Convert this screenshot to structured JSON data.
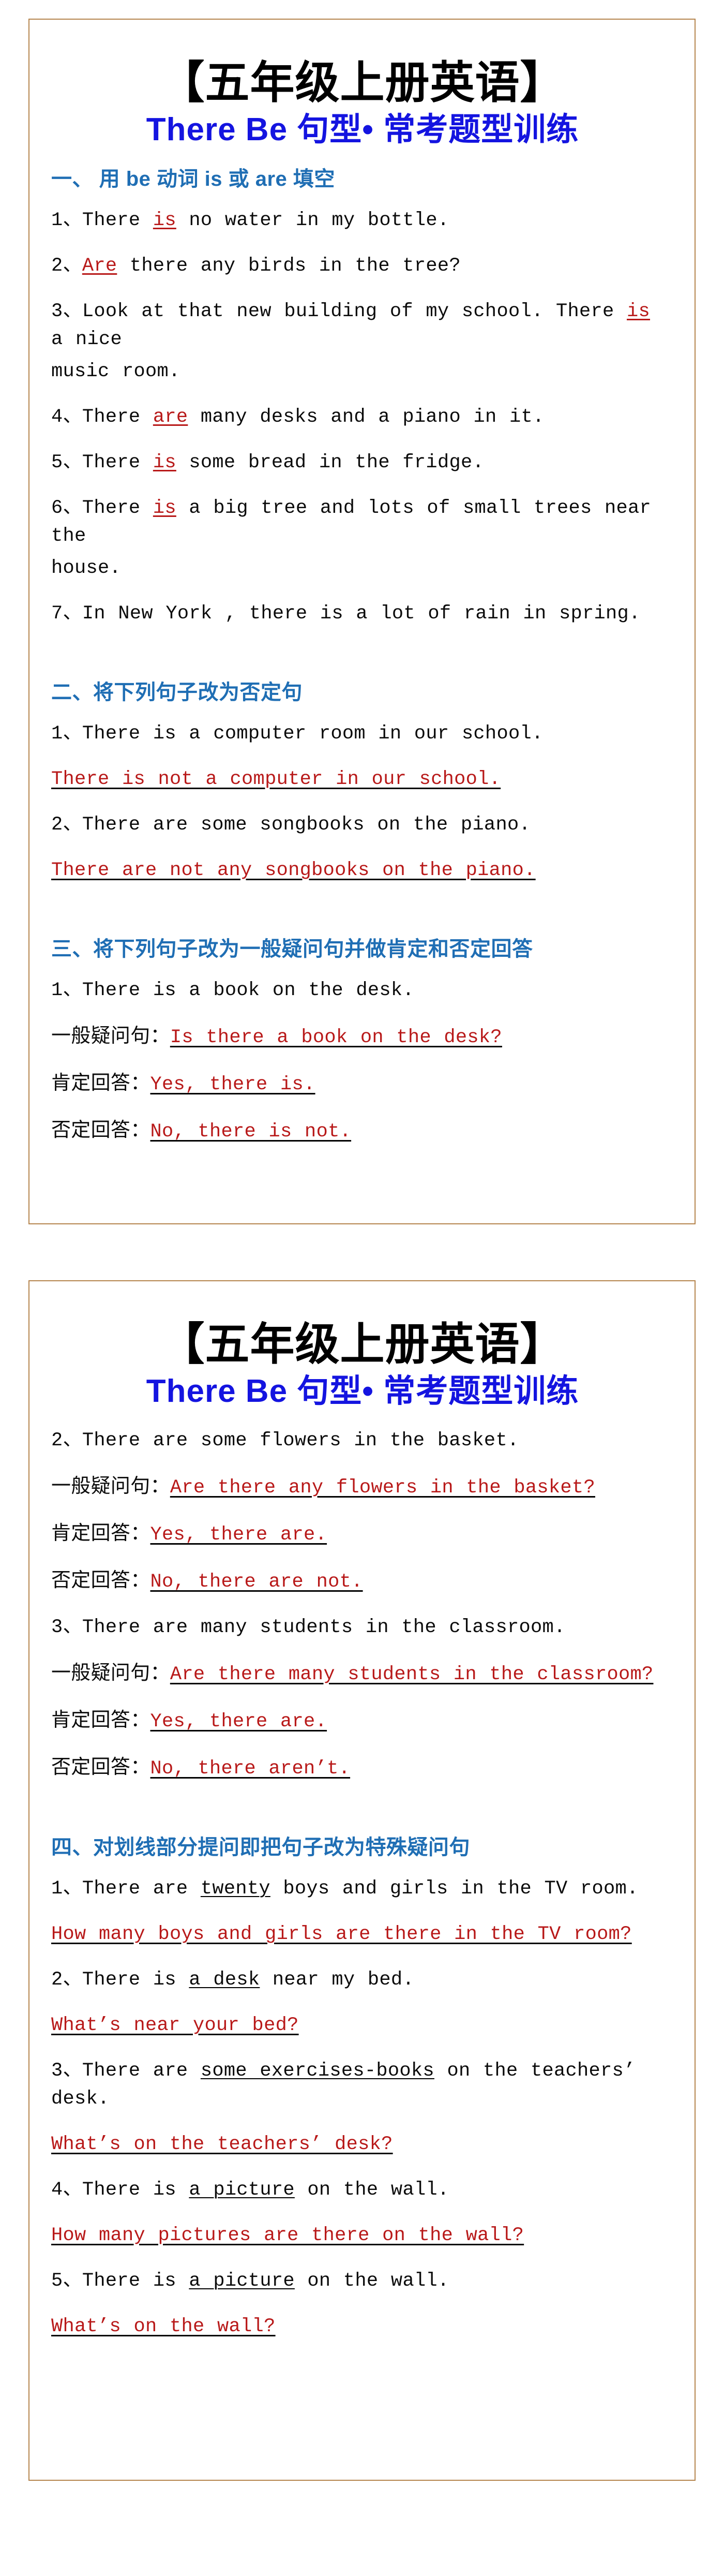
{
  "colors": {
    "border": "#b5854e",
    "title_black": "#000000",
    "title_blue": "#1414e0",
    "section_blue": "#1f6eb4",
    "answer_red": "#b81919",
    "body_black": "#0b0b0b"
  },
  "header": {
    "title_main": "【五年级上册英语】",
    "title_sub_en": "There Be ",
    "title_sub_zh": "句型• 常考题型训练"
  },
  "labels": {
    "yiban": "一般疑问句：",
    "kending": "肯定回答：",
    "fouding": "否定回答："
  },
  "page1": {
    "sections": [
      {
        "heading": "一、 用 be 动词 is 或 are 填空",
        "items": [
          {
            "num": "1、",
            "pre": "There ",
            "fill": "is",
            "post": " no water in my bottle."
          },
          {
            "num": "2、",
            "pre": "",
            "fill": "Are",
            "post": " there any birds in the tree?"
          },
          {
            "num": "3、",
            "pre": "Look at that new building of my school. There ",
            "fill": "is",
            "post": " a nice",
            "cont": "music room."
          },
          {
            "num": "4、",
            "pre": "There ",
            "fill": "are",
            "post": " many desks and a piano in it."
          },
          {
            "num": "5、",
            "pre": "There ",
            "fill": "is",
            "post": " some bread in the fridge."
          },
          {
            "num": "6、",
            "pre": "There ",
            "fill": "is",
            "post": " a big tree and lots of small trees near the",
            "cont": "house."
          },
          {
            "num": "7、",
            "plain": "In New York , there is a lot of rain in spring."
          }
        ]
      },
      {
        "heading": "二、将下列句子改为否定句",
        "items": [
          {
            "num": "1、",
            "question": "There is a computer room in our school.",
            "answer": "There is not a computer in our school."
          },
          {
            "num": "2、",
            "question": "There are some songbooks on the piano.",
            "answer": "There are not any songbooks on the piano."
          }
        ]
      },
      {
        "heading": "三、将下列句子改为一般疑问句并做肯定和否定回答",
        "items": [
          {
            "num": "1、",
            "question": "There is a book on the desk.",
            "yiban": "Is there a book on the desk?",
            "kending": "Yes, there is.",
            "fouding": "No, there is not."
          }
        ]
      }
    ]
  },
  "page2": {
    "sections": [
      {
        "heading": null,
        "items": [
          {
            "num": "2、",
            "question": "There are some flowers in the basket.",
            "yiban": "Are there any flowers in the basket?",
            "kending": "Yes, there are.",
            "fouding": "No, there are not."
          },
          {
            "num": "3、",
            "question": "There are many students in the classroom.",
            "yiban": "Are there many students in the classroom?",
            "kending": "Yes, there are.",
            "fouding": "No, there aren’t."
          }
        ]
      },
      {
        "heading": "四、对划线部分提问即把句子改为特殊疑问句",
        "items": [
          {
            "num": "1、",
            "pre": "There are ",
            "underlined": "twenty",
            "post": " boys and girls in the TV room.",
            "answer": "How many boys and girls are there in the TV room?"
          },
          {
            "num": "2、",
            "pre": "There is ",
            "underlined": "a desk",
            "post": " near my bed.",
            "answer": "What’s near your bed?"
          },
          {
            "num": "3、",
            "pre": "There are ",
            "underlined": "some exercises-books",
            "post": " on the teachers’ desk.",
            "answer": "What’s on the teachers’ desk?"
          },
          {
            "num": "4、",
            "pre": "There is ",
            "underlined": "a picture",
            "post": " on the wall.",
            "answer": "How many pictures are there on the wall?"
          },
          {
            "num": "5、",
            "pre": "There is ",
            "underlined": "a picture",
            "post": " on the wall.",
            "answer": "What’s on the wall?"
          }
        ]
      }
    ]
  }
}
